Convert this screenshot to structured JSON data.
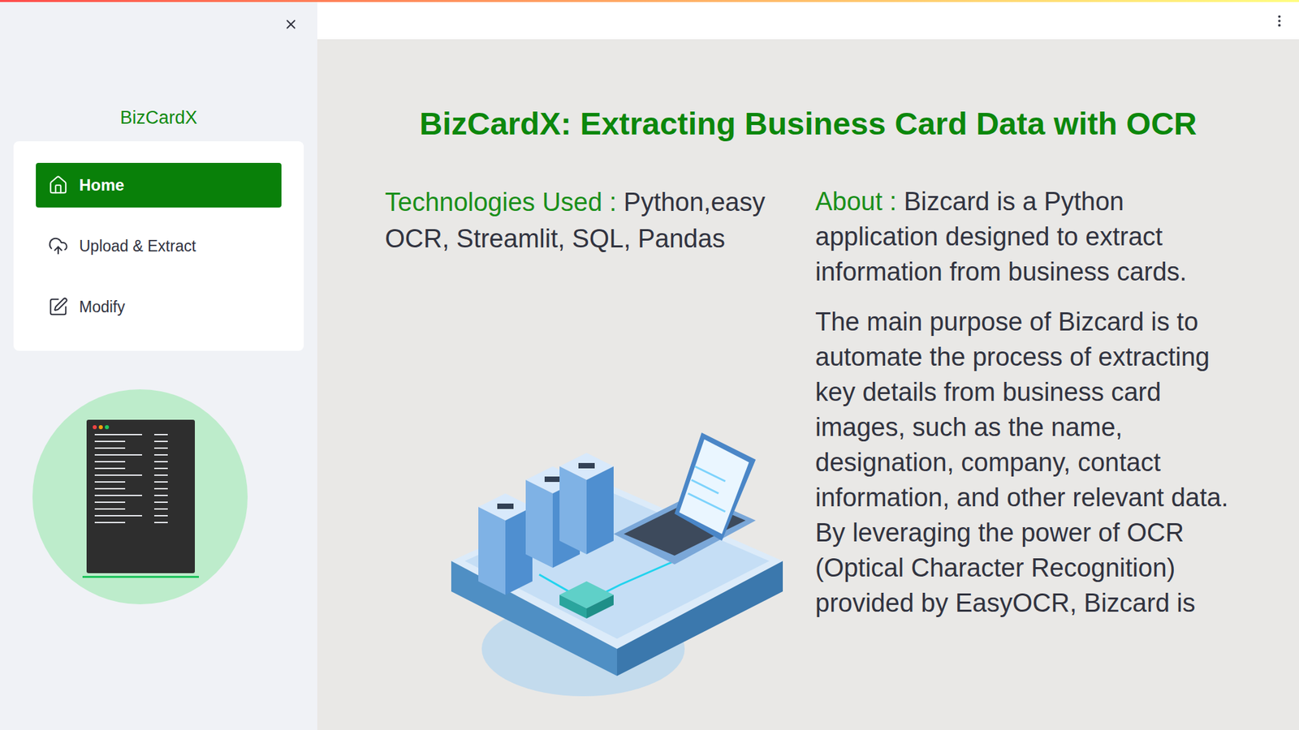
{
  "sidebar": {
    "title": "BizCardX",
    "items": [
      {
        "label": "Home",
        "selected": true
      },
      {
        "label": "Upload & Extract",
        "selected": false
      },
      {
        "label": "Modify",
        "selected": false
      }
    ]
  },
  "main": {
    "title": "BizCardX: Extracting Business Card Data with OCR",
    "technologies": {
      "label": "Technologies Used :",
      "value": "Python,easy OCR, Streamlit, SQL, Pandas"
    },
    "about": {
      "label": "About :",
      "text": "Bizcard is a Python application designed to extract information from business cards.",
      "paragraph": "The main purpose of Bizcard is to automate the process of extracting key details from business card images, such as the name, designation, company, contact information, and other relevant data. By leveraging the power of OCR (Optical Character Recognition) provided by EasyOCR, Bizcard is"
    }
  }
}
